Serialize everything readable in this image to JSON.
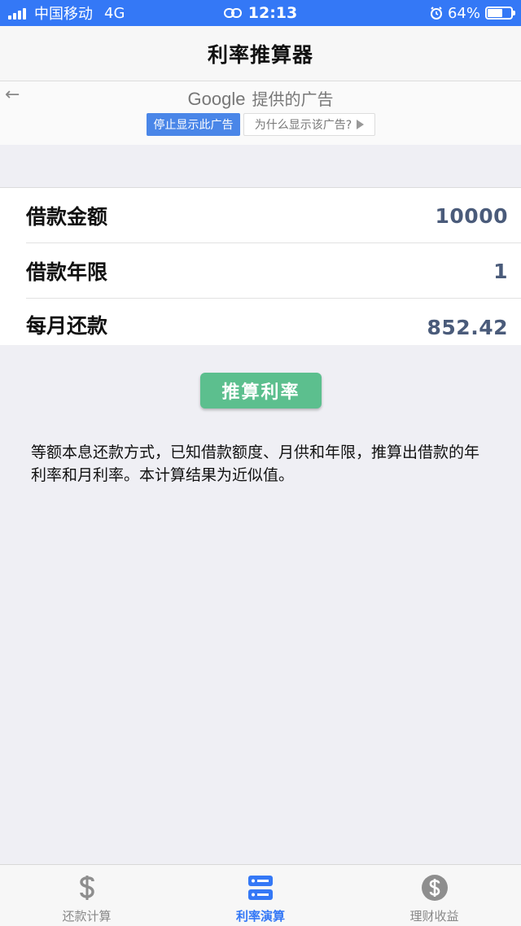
{
  "status_bar": {
    "carrier": "中国移动",
    "network": "4G",
    "time": "12:13",
    "battery": "64%",
    "battery_level": 0.64
  },
  "nav": {
    "title": "利率推算器"
  },
  "ad": {
    "provider_brand": "Google",
    "provider_suffix": "提供的广告",
    "stop_label": "停止显示此广告",
    "why_label": "为什么显示该广告?"
  },
  "form": {
    "rows": [
      {
        "label": "借款金额",
        "value": "10000"
      },
      {
        "label": "借款年限",
        "value": "1"
      },
      {
        "label": "每月还款",
        "value": "852.42"
      }
    ]
  },
  "actions": {
    "calculate_label": "推算利率"
  },
  "description": "等额本息还款方式，已知借款额度、月供和年限，推算出借款的年利率和月利率。本计算结果为近似值。",
  "tabs": [
    {
      "label": "还款计算",
      "icon": "dollar-sign-icon",
      "active": false
    },
    {
      "label": "利率演算",
      "icon": "server-icon",
      "active": true
    },
    {
      "label": "理财收益",
      "icon": "dollar-coin-icon",
      "active": false
    }
  ],
  "colors": {
    "status_bar_bg": "#3478f6",
    "accent": "#3478f6",
    "calc_button": "#5cbf8e",
    "value_text": "#4a5b7a"
  }
}
